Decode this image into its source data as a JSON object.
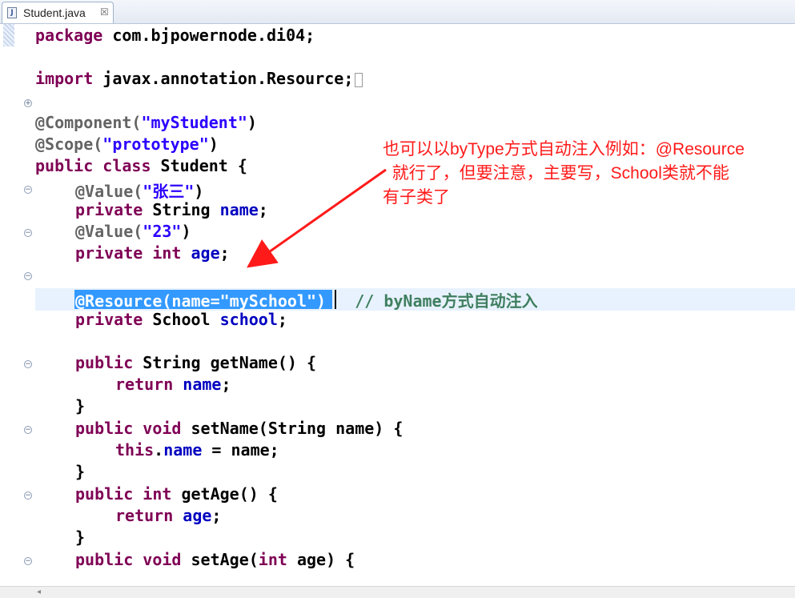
{
  "tab": {
    "label": "Student.java",
    "close": "☒",
    "icon": "java-file-icon"
  },
  "code": {
    "line_package": {
      "kw": "package",
      "rest": " com.bjpowernode.di04;"
    },
    "line_import": {
      "kw": "import",
      "rest": " javax.annotation.Resource;"
    },
    "line_component": {
      "ann": "@Component(",
      "str": "\"myStudent\"",
      "close": ")"
    },
    "line_scope": {
      "ann": "@Scope(",
      "str": "\"prototype\"",
      "close": ")"
    },
    "line_class": {
      "kw": "public class",
      "rest": " Student {"
    },
    "line_value1": {
      "ann": "@Value(",
      "str": "\"张三\"",
      "close": ")"
    },
    "line_name": {
      "kw": "private",
      "type": " String ",
      "field": "name",
      "end": ";"
    },
    "line_value2": {
      "ann": "@Value(",
      "str": "\"23\"",
      "close": ")"
    },
    "line_age": {
      "kw": "private int",
      "sp": " ",
      "field": "age",
      "end": ";"
    },
    "line_resource": {
      "text": "@Resource(name=\"mySchool\")",
      "comment": "// byName方式自动注入"
    },
    "line_school": {
      "kw": "private",
      "type": " School ",
      "field": "school",
      "end": ";"
    },
    "line_getname": {
      "kw": "public",
      "rest": " String getName() {"
    },
    "line_return_name": {
      "kw": "return",
      "sp": " ",
      "field": "name",
      "end": ";"
    },
    "brace1": "}",
    "line_setname": {
      "kw": "public void",
      "rest": " setName(String name) {"
    },
    "line_this_name": {
      "kw": "this",
      "dot": ".",
      "field": "name",
      "rest": " = name;"
    },
    "brace2": "}",
    "line_getage": {
      "kw": "public int",
      "rest": " getAge() {"
    },
    "line_return_age": {
      "kw": "return",
      "sp": " ",
      "field": "age",
      "end": ";"
    },
    "brace3": "}",
    "line_setage": {
      "kw": "public void",
      "rest": " setAge(",
      "kw2": "int",
      "rest2": " age) {"
    }
  },
  "callout": {
    "line1": "也可以以byType方式自动注入例如：@Resource",
    "line2": "  就行了，但要注意，主要写，School类就不能",
    "line3": "有子类了"
  },
  "colors": {
    "keyword": "#7f0055",
    "string": "#2a00ff",
    "field": "#0000c0",
    "comment": "#3f7f5f",
    "selection": "#3399ff",
    "callout": "#ff1a1a"
  }
}
